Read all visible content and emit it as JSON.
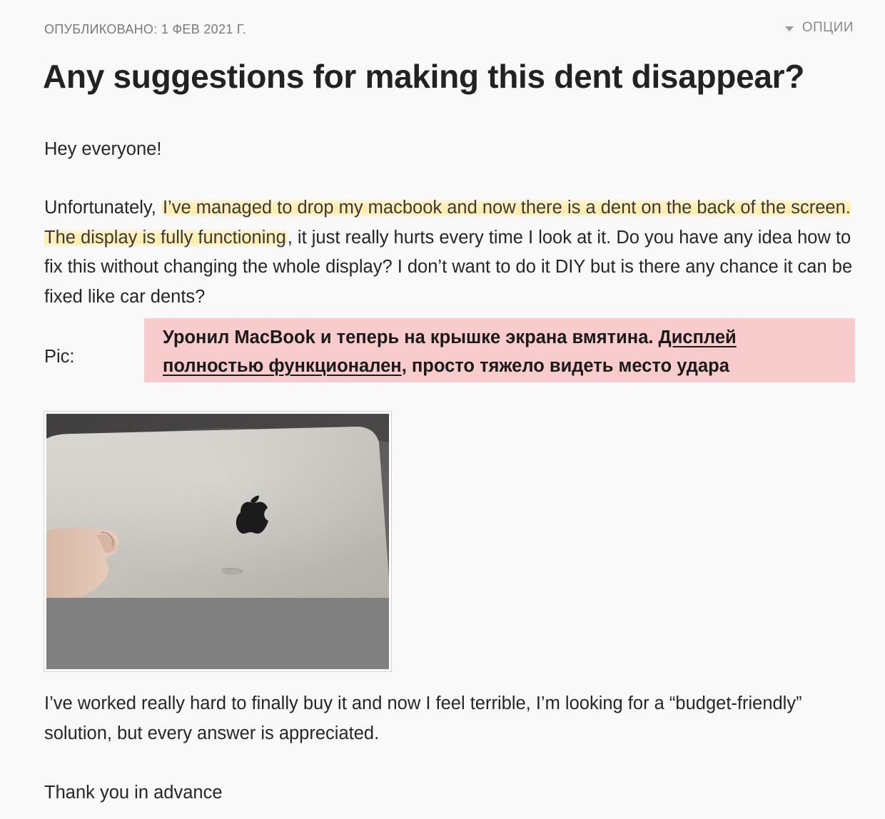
{
  "post": {
    "meta": "ОПУБЛИКОВАНО: 1 ФЕВ 2021 Г.",
    "options_label": "ОПЦИИ",
    "options_icon": "caret-down-icon",
    "title": "Any suggestions for making this dent disappear?",
    "greeting": "Hey everyone!",
    "body": {
      "intro": "Unfortunately, ",
      "highlight": "I’ve managed to drop my macbook and now there is a dent on the back of the screen. The display is fully functioning",
      "rest": ", it just really hurts every time I look at it. Do you have any idea how to fix this without changing the whole display? I don’t want to do it DIY but is there any chance it can be fixed like car dents?"
    },
    "pic_label": "Pic:",
    "closing": "I’ve worked really hard to finally buy it and now I feel terrible, I’m looking for a “budget-friendly” solution, but every answer is appreciated.",
    "signoff": "Thank you in advance"
  },
  "annotation": {
    "part1": "Уронил MacBook и теперь на крышке экрана вмятина",
    "sep": ". ",
    "underlined": "Дисплей полностью функционален",
    "part2": ", просто тяжело видеть место удара",
    "background": "#f8cbcc"
  },
  "colors": {
    "highlight": "#fdf0b4",
    "meta_text": "#7a7a7a",
    "body_text": "#262626"
  }
}
